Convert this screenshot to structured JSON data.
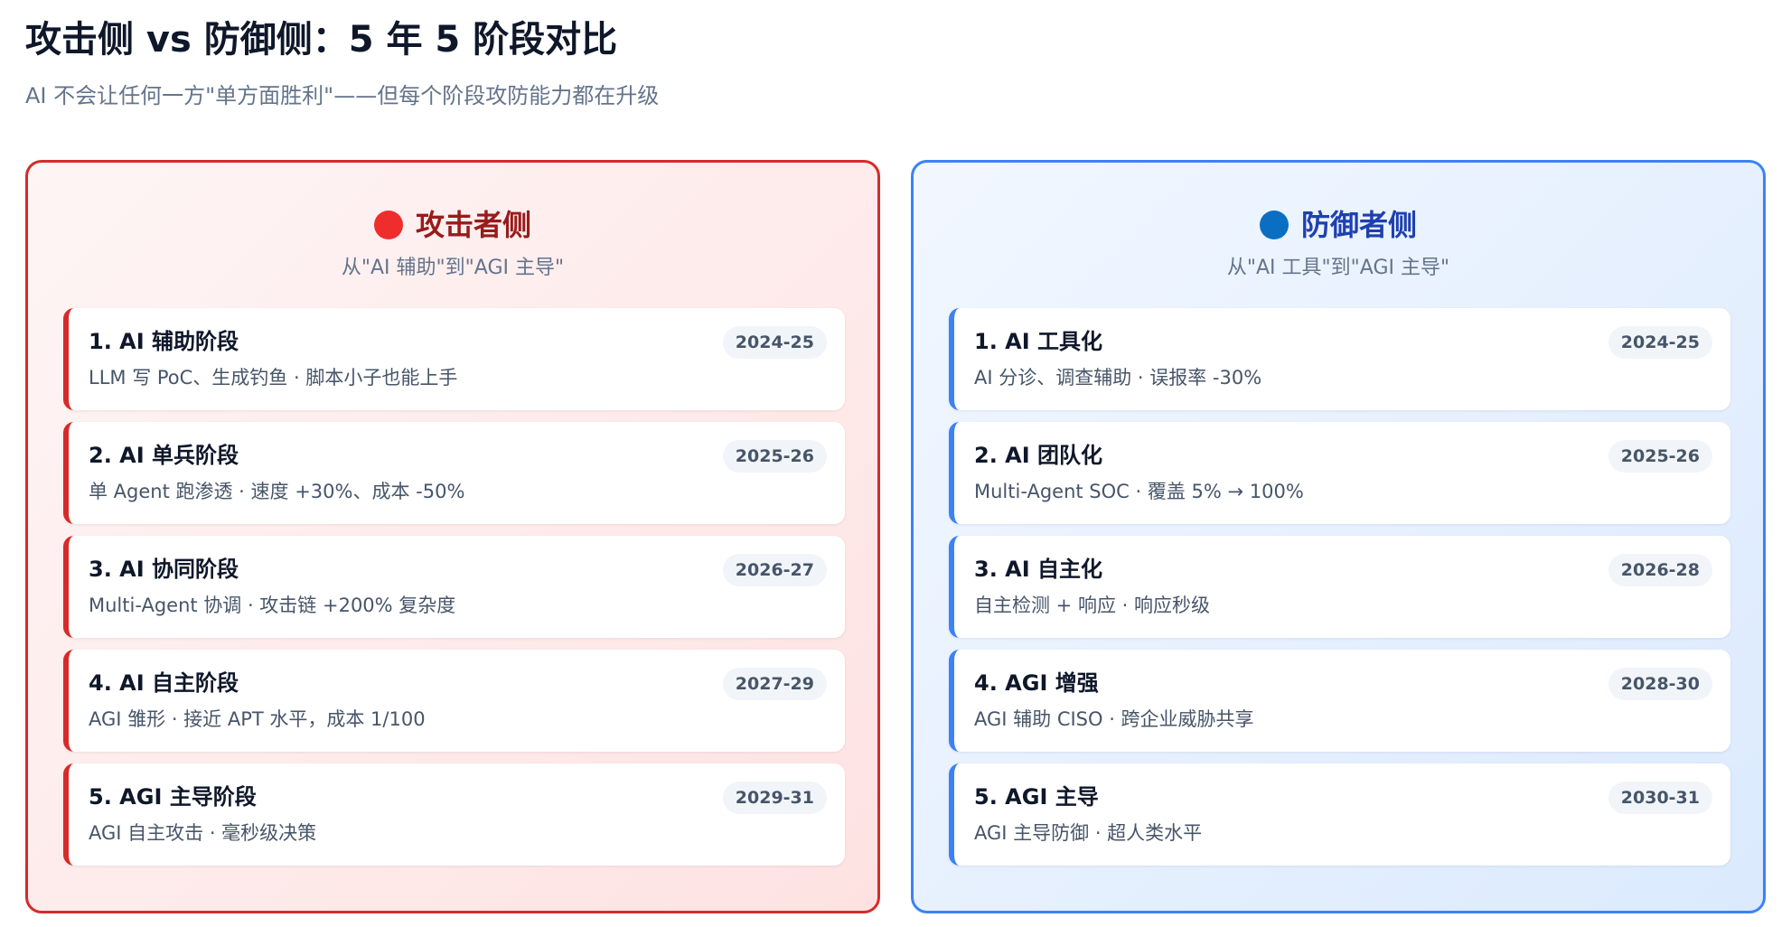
{
  "page": {
    "title": "攻击侧 vs 防御侧：5 年 5 阶段对比",
    "subtitle": "AI 不会让任何一方\"单方面胜利\"——但每个阶段攻防能力都在升级"
  },
  "colors": {
    "attack_accent": "#d62a2a",
    "attack_dot": "#ef2d2d",
    "attack_title": "#991b1b",
    "defense_accent": "#3b82f6",
    "defense_dot": "#0a6fc2",
    "defense_title": "#1e40af"
  },
  "attack": {
    "title": "攻击者侧",
    "subtitle": "从\"AI 辅助\"到\"AGI 主导\"",
    "icon": "red-circle-icon",
    "stages": [
      {
        "name": "1. AI 辅助阶段",
        "desc": "LLM 写 PoC、生成钓鱼 · 脚本小子也能上手",
        "period": "2024-25"
      },
      {
        "name": "2. AI 单兵阶段",
        "desc": "单 Agent 跑渗透 · 速度 +30%、成本 -50%",
        "period": "2025-26"
      },
      {
        "name": "3. AI 协同阶段",
        "desc": "Multi-Agent 协调 · 攻击链 +200% 复杂度",
        "period": "2026-27"
      },
      {
        "name": "4. AI 自主阶段",
        "desc": "AGI 雏形 · 接近 APT 水平，成本 1/100",
        "period": "2027-29"
      },
      {
        "name": "5. AGI 主导阶段",
        "desc": "AGI 自主攻击 · 毫秒级决策",
        "period": "2029-31"
      }
    ]
  },
  "defense": {
    "title": "防御者侧",
    "subtitle": "从\"AI 工具\"到\"AGI 主导\"",
    "icon": "blue-circle-icon",
    "stages": [
      {
        "name": "1. AI 工具化",
        "desc": "AI 分诊、调查辅助 · 误报率 -30%",
        "period": "2024-25"
      },
      {
        "name": "2. AI 团队化",
        "desc": "Multi-Agent SOC · 覆盖 5% → 100%",
        "period": "2025-26"
      },
      {
        "name": "3. AI 自主化",
        "desc": "自主检测 + 响应 · 响应秒级",
        "period": "2026-28"
      },
      {
        "name": "4. AGI 增强",
        "desc": "AGI 辅助 CISO · 跨企业威胁共享",
        "period": "2028-30"
      },
      {
        "name": "5. AGI 主导",
        "desc": "AGI 主导防御 · 超人类水平",
        "period": "2030-31"
      }
    ]
  }
}
